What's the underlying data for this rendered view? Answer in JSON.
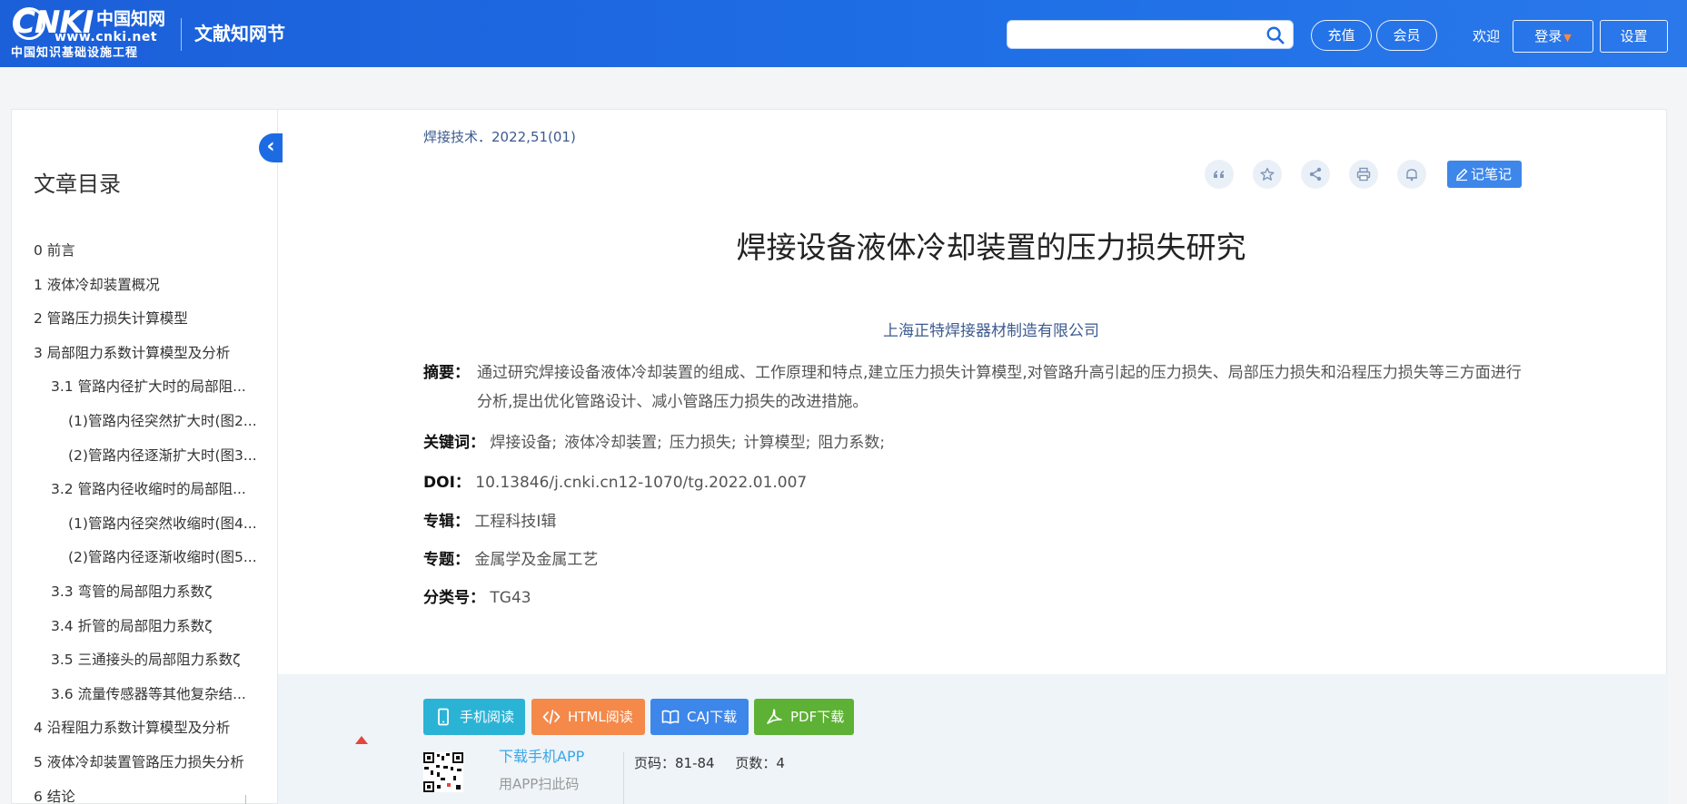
{
  "header": {
    "logo_big": "cnki",
    "logo_cn": "中国知网",
    "logo_url": "www.cnki.net",
    "logo_sub": "中国知识基础设施工程",
    "site_title": "文献知网节",
    "search_placeholder": "",
    "buttons": {
      "recharge": "充值",
      "member": "会员",
      "login": "登录",
      "settings": "设置"
    },
    "welcome": "欢迎"
  },
  "toc": {
    "title": "文章目录",
    "items": [
      {
        "label": "0 前言",
        "level": 1
      },
      {
        "label": "1 液体冷却装置概况",
        "level": 1
      },
      {
        "label": "2 管路压力损失计算模型",
        "level": 1
      },
      {
        "label": "3 局部阻力系数计算模型及分析",
        "level": 1
      },
      {
        "label": "3.1 管路内径扩大时的局部阻...",
        "level": 2
      },
      {
        "label": "(1)管路内径突然扩大时(图2...",
        "level": 3
      },
      {
        "label": "(2)管路内径逐渐扩大时(图3...",
        "level": 3
      },
      {
        "label": "3.2 管路内径收缩时的局部阻...",
        "level": 2
      },
      {
        "label": "(1)管路内径突然收缩时(图4...",
        "level": 3
      },
      {
        "label": "(2)管路内径逐渐收缩时(图5...",
        "level": 3
      },
      {
        "label": "3.3 弯管的局部阻力系数ζ",
        "level": 2
      },
      {
        "label": "3.4 折管的局部阻力系数ζ",
        "level": 2
      },
      {
        "label": "3.5 三通接头的局部阻力系数ζ",
        "level": 2
      },
      {
        "label": "3.6 流量传感器等其他复杂结...",
        "level": 2
      },
      {
        "label": "4 沿程阻力系数计算模型及分析",
        "level": 1
      },
      {
        "label": "5 液体冷却装置管路压力损失分析",
        "level": 1
      },
      {
        "label": "6 结论",
        "level": 1
      }
    ]
  },
  "article": {
    "source": "焊接技术．2022,51(01)",
    "title": "焊接设备液体冷却装置的压力损失研究",
    "organization": "上海正特焊接器材制造有限公司",
    "abstract_label": "摘要：",
    "abstract": "通过研究焊接设备液体冷却装置的组成、工作原理和特点,建立压力损失计算模型,对管路升高引起的压力损失、局部压力损失和沿程压力损失等三方面进行分析,提出优化管路设计、减小管路压力损失的改进措施。",
    "keywords_label": "关键词：",
    "keywords": [
      "焊接设备;",
      "液体冷却装置;",
      "压力损失;",
      "计算模型;",
      "阻力系数;"
    ],
    "doi_label": "DOI：",
    "doi": "10.13846/j.cnki.cn12-1070/tg.2022.01.007",
    "series_label": "专辑：",
    "series": "工程科技Ⅰ辑",
    "topic_label": "专题：",
    "topic": "金属学及金属工艺",
    "clc_label": "分类号：",
    "clc": "TG43"
  },
  "tools": {
    "note_label": "记笔记",
    "icons": [
      "quote-icon",
      "star-icon",
      "share-icon",
      "print-icon",
      "bell-icon"
    ]
  },
  "actions": {
    "mobile_read": "手机阅读",
    "html_read": "HTML阅读",
    "caj_download": "CAJ下载",
    "pdf_download": "PDF下载",
    "colors": {
      "mobile": "#2bb3d6",
      "html": "#f4894a",
      "caj": "#3d86ea",
      "pdf": "#5db134"
    }
  },
  "app": {
    "download_label": "下载手机APP",
    "scan_hint": "用APP扫此码"
  },
  "pages": {
    "range_label": "页码：",
    "range": "81-84",
    "count_label": "页数：",
    "count": "4"
  }
}
